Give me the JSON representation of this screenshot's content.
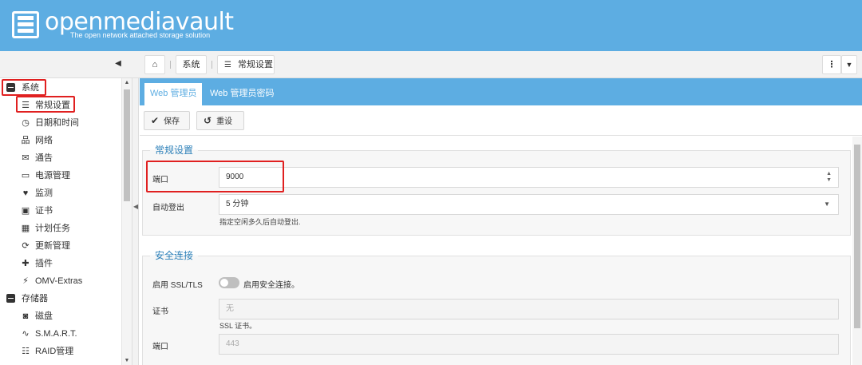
{
  "header": {
    "title": "openmediavault",
    "subtitle": "The open network attached storage solution"
  },
  "toolbar": {
    "home_icon": "home-icon",
    "breadcrumbs": [
      "系统",
      "常规设置"
    ]
  },
  "sidebar": {
    "items": [
      {
        "label": "系统",
        "icon": "minus-box-icon",
        "level": 0
      },
      {
        "label": "常规设置",
        "icon": "sliders-icon",
        "level": 1
      },
      {
        "label": "日期和时间",
        "icon": "clock-icon",
        "level": 1
      },
      {
        "label": "网络",
        "icon": "network-icon",
        "level": 1
      },
      {
        "label": "通告",
        "icon": "envelope-icon",
        "level": 1
      },
      {
        "label": "电源管理",
        "icon": "battery-icon",
        "level": 1
      },
      {
        "label": "监测",
        "icon": "heartbeat-icon",
        "level": 1
      },
      {
        "label": "证书",
        "icon": "certificate-icon",
        "level": 1
      },
      {
        "label": "计划任务",
        "icon": "calendar-clock-icon",
        "level": 1
      },
      {
        "label": "更新管理",
        "icon": "refresh-icon",
        "level": 1
      },
      {
        "label": "插件",
        "icon": "puzzle-icon",
        "level": 1
      },
      {
        "label": "OMV-Extras",
        "icon": "plug-icon",
        "level": 1
      },
      {
        "label": "存储器",
        "icon": "minus-box-icon",
        "level": 0
      },
      {
        "label": "磁盘",
        "icon": "disk-icon",
        "level": 1
      },
      {
        "label": "S.M.A.R.T.",
        "icon": "pulse-icon",
        "level": 1
      },
      {
        "label": "RAID管理",
        "icon": "database-icon",
        "level": 1
      }
    ]
  },
  "tabs": [
    {
      "label": "Web 管理员",
      "active": true
    },
    {
      "label": "Web 管理员密码",
      "active": false
    }
  ],
  "actions": {
    "save_label": "保存",
    "reset_label": "重设"
  },
  "general": {
    "legend": "常规设置",
    "port_label": "端口",
    "port_value": "9000",
    "autologout_label": "自动登出",
    "autologout_value": "5 分钟",
    "autologout_hint": "指定空闲多久后自动登出."
  },
  "secure": {
    "legend": "安全连接",
    "ssl_label": "启用 SSL/TLS",
    "ssl_toggle_label": "启用安全连接。",
    "ssl_enabled": false,
    "cert_label": "证书",
    "cert_value": "无",
    "cert_hint": "SSL 证书。",
    "port_label": "端口",
    "port_value": "443"
  },
  "colors": {
    "header": "#5dade2",
    "accent": "#2b7fb8",
    "highlight": "#e02020"
  }
}
